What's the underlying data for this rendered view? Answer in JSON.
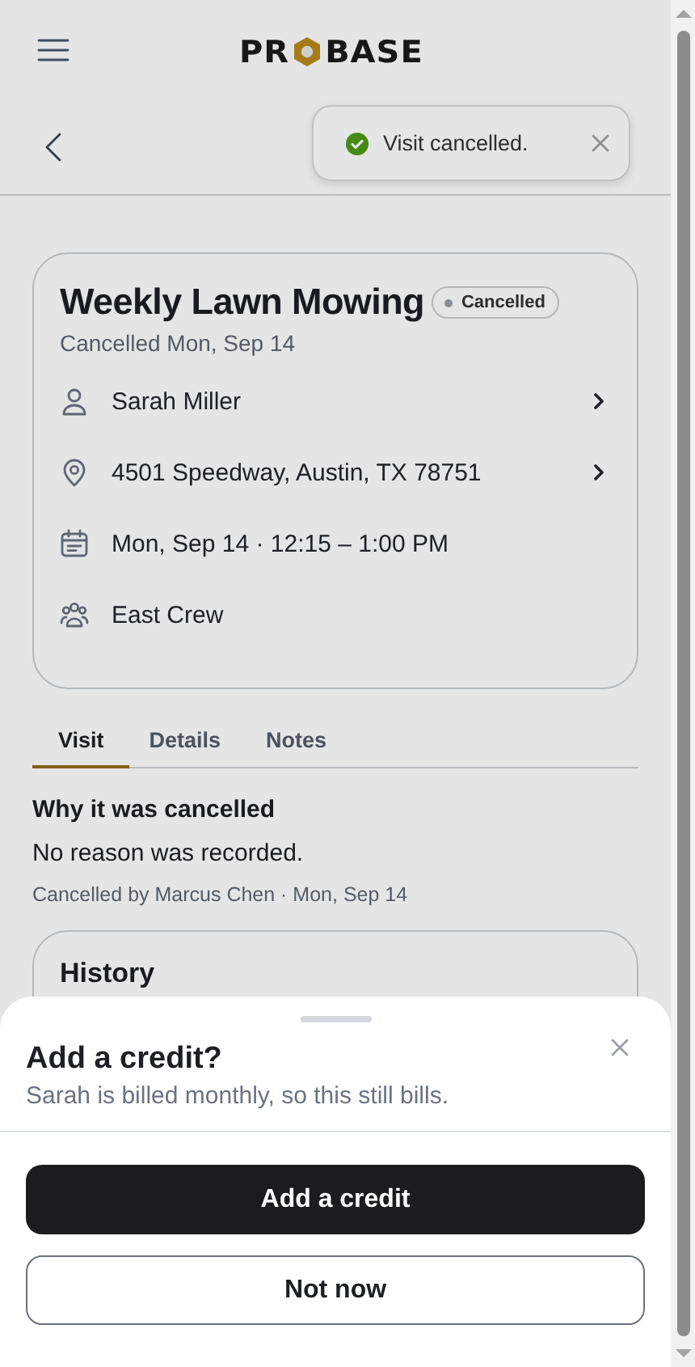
{
  "logo": {
    "before": "PR",
    "after": "BASE"
  },
  "toast": {
    "message": "Visit cancelled."
  },
  "visit": {
    "title": "Weekly Lawn Mowing",
    "status": "Cancelled",
    "subtitle": "Cancelled Mon, Sep 14",
    "rows": [
      {
        "kind": "person",
        "text": "Sarah Miller",
        "link": true
      },
      {
        "kind": "location",
        "text": "4501 Speedway, Austin, TX 78751",
        "link": true
      },
      {
        "kind": "calendar",
        "text": "Mon, Sep 14 · 12:15 – 1:00 PM",
        "link": false
      },
      {
        "kind": "crew",
        "text": "East Crew",
        "link": false
      }
    ]
  },
  "tabs": [
    {
      "label": "Visit",
      "selected": true
    },
    {
      "label": "Details",
      "selected": false
    },
    {
      "label": "Notes",
      "selected": false
    }
  ],
  "reason": {
    "heading": "Why it was cancelled",
    "text": "No reason was recorded.",
    "meta": "Cancelled by Marcus Chen · Mon, Sep 14"
  },
  "history": {
    "title": "History"
  },
  "sheet": {
    "title": "Add a credit?",
    "subtitle": "Sarah is billed monthly, so this still bills.",
    "primary": "Add a credit",
    "secondary": "Not now"
  }
}
